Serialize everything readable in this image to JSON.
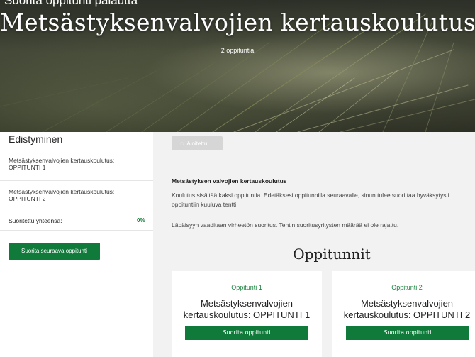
{
  "page": {
    "partial_top_text": "Suorita oppitunti  palautta",
    "hero_title": "Metsästyksenvalvojien kertauskoulutus",
    "hero_subtitle": "2 oppituntia"
  },
  "sidebar": {
    "title": "Edistyminen",
    "items": [
      {
        "label": "Metsästyksenvalvojien kertauskoulutus: OPPITUNTI 1"
      },
      {
        "label": "Metsästyksenvalvojien kertauskoulutus: OPPITUNTI 2"
      }
    ],
    "total_label": "Suoritettu yhteensä:",
    "total_value": "0%",
    "next_button": "Suorita seuraava oppitunti"
  },
  "main": {
    "status_badge": "Aloitettu",
    "heading": "Metsästyksen valvojien kertauskoulutus",
    "paragraph1": "Koulutus sisältää kaksi oppituntia. Edetäksesi oppitunnilla seuraavalle, sinun tulee suorittaa hyväksytysti oppituntiin kuuluva tentti.",
    "paragraph2": "Läpäisyyn vaaditaan virheetön suoritus. Tentin suoritusyritysten määrää ei ole rajattu.",
    "section_title": "Oppitunnit",
    "cards": [
      {
        "number": "Oppitunti 1",
        "title": "Metsästyksenvalvojien kertauskoulutus: OPPITUNTI 1",
        "button": "Suorita oppitunti"
      },
      {
        "number": "Oppitunti 2",
        "title": "Metsästyksenvalvojien kertauskoulutus: OPPITUNTI 2",
        "button": "Suorita oppitunti"
      }
    ]
  },
  "colors": {
    "accent_green": "#0f7a3a",
    "status_badge_bg": "#d6d6d6"
  },
  "icons": {
    "status_badge_icon": "spinner-icon"
  }
}
